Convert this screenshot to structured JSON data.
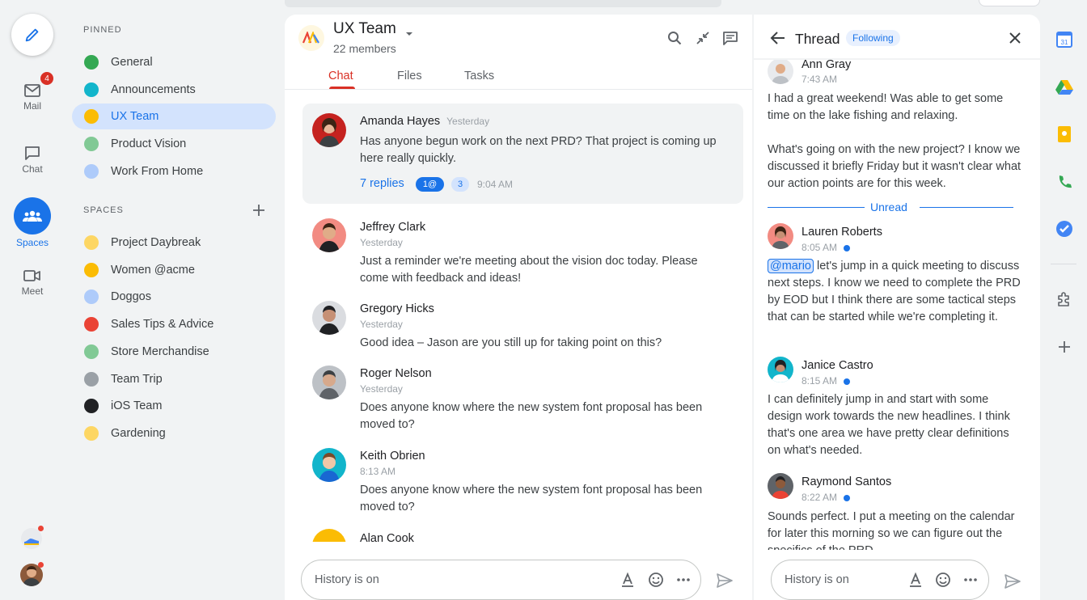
{
  "rail": {
    "mail_label": "Mail",
    "mail_badge": "4",
    "chat_label": "Chat",
    "spaces_label": "Spaces",
    "meet_label": "Meet"
  },
  "nav": {
    "pinned_header": "PINNED",
    "pinned": [
      {
        "label": "General",
        "icon": "leaf-icon",
        "color": "#34a853"
      },
      {
        "label": "Announcements",
        "icon": "megaphone-icon",
        "color": "#12b5cb"
      },
      {
        "label": "UX Team",
        "icon": "ux-team-icon",
        "color": "#fbbc04"
      },
      {
        "label": "Product Vision",
        "icon": "vision-icon",
        "color": "#81c995"
      },
      {
        "label": "Work From Home",
        "icon": "globe-icon",
        "color": "#aecbfa"
      }
    ],
    "spaces_header": "SPACES",
    "spaces": [
      {
        "label": "Project Daybreak",
        "icon": "daybreak-icon",
        "color": "#fdd663"
      },
      {
        "label": "Women @acme",
        "icon": "women-icon",
        "color": "#fbbc04"
      },
      {
        "label": "Doggos",
        "icon": "dog-icon",
        "color": "#aecbfa"
      },
      {
        "label": "Sales Tips & Advice",
        "icon": "sales-icon",
        "color": "#ea4335"
      },
      {
        "label": "Store Merchandise",
        "icon": "store-icon",
        "color": "#81c995"
      },
      {
        "label": "Team Trip",
        "icon": "trip-icon",
        "color": "#9aa0a6"
      },
      {
        "label": "iOS Team",
        "icon": "ios-icon",
        "color": "#202124"
      },
      {
        "label": "Gardening",
        "icon": "garden-icon",
        "color": "#fdd663"
      }
    ]
  },
  "chat": {
    "title": "UX Team",
    "members": "22 members",
    "tabs": [
      "Chat",
      "Files",
      "Tasks"
    ],
    "messages": [
      {
        "name": "Amanda Hayes",
        "time": "Yesterday",
        "text": "Has anyone begun work on the next PRD? That project is coming up here really quickly.",
        "replies": "7 replies",
        "mention_count": "1@",
        "unread_count": "3",
        "reply_time": "9:04 AM",
        "avatar_color": "#c5221f"
      },
      {
        "name": "Jeffrey Clark",
        "time": "Yesterday",
        "text": "Just a reminder we're meeting about the vision doc today. Please come with feedback and ideas!",
        "avatar_color": "#f28b82"
      },
      {
        "name": "Gregory Hicks",
        "time": "Yesterday",
        "text": "Good idea – Jason are you still up for taking point on this?",
        "avatar_color": "#dadce0"
      },
      {
        "name": "Roger Nelson",
        "time": "Yesterday",
        "text": "Does anyone know where the new system font proposal has been moved to?",
        "avatar_color": "#bdc1c6"
      },
      {
        "name": "Keith Obrien",
        "time": "8:13 AM",
        "text": "Does anyone know where the new system font proposal has been moved to?",
        "avatar_color": "#12b5cb"
      },
      {
        "name": "Alan Cook",
        "avatar_color": "#fbbc04"
      }
    ],
    "composer_placeholder": "History is on"
  },
  "thread": {
    "title": "Thread",
    "following": "Following",
    "unread_label": "Unread",
    "posts": [
      {
        "name": "Ann Gray",
        "time": "7:43 AM",
        "text1": "I had a great weekend! Was able to get some time on the lake fishing and relaxing.",
        "text2": "What's going on with the new project? I know we discussed it briefly Friday but it wasn't clear what our action points are for this week.",
        "avatar_color": "#e8eaed"
      },
      {
        "name": "Lauren Roberts",
        "time": "8:05 AM",
        "mention": "@mario",
        "text": "let's jump in a quick meeting to discuss next steps. I know we need to complete the PRD by EOD but I think there are some tactical steps that can be started while we're completing it.",
        "avatar_color": "#f28b82"
      },
      {
        "name": "Janice Castro",
        "time": "8:15 AM",
        "text": "I can definitely jump in and start with some design work towards the new headlines. I think that's one area we have pretty clear definitions on what's needed.",
        "avatar_color": "#12b5cb"
      },
      {
        "name": "Raymond Santos",
        "time": "8:22 AM",
        "text": "Sounds perfect. I put a meeting on the calendar for later this morning so we can figure out the specifics of the PRD.",
        "avatar_color": "#5f6368"
      }
    ],
    "composer_placeholder": "History is on"
  },
  "colors": {
    "accent": "#1a73e8",
    "chat_tab": "#d93025",
    "unread": "#1a73e8"
  }
}
